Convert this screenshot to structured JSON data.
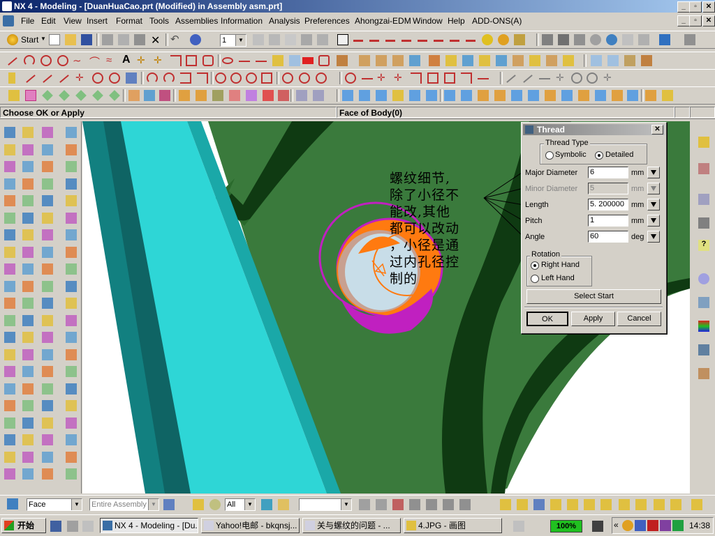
{
  "window": {
    "title": "NX 4 - Modeling - [DuanHuaCao.prt (Modified)  in Assembly asm.prt]",
    "minimize": "_",
    "restore": "▫",
    "close": "✕"
  },
  "menu": [
    "File",
    "Edit",
    "View",
    "Insert",
    "Format",
    "Tools",
    "Assemblies",
    "Information",
    "Analysis",
    "Preferences",
    "Ahongzai-EDM",
    "Window",
    "Help",
    "ADD-ONS(A)"
  ],
  "toolbar": {
    "start_label": "Start",
    "layer_value": "1"
  },
  "cue": {
    "prompt": "Choose OK or Apply",
    "status": "Face of Body(0)"
  },
  "dialog": {
    "title": "Thread",
    "thread_type_label": "Thread Type",
    "thread_type_options": [
      "Symbolic",
      "Detailed"
    ],
    "thread_type_selected": "Detailed",
    "fields": [
      {
        "label": "Major Diameter",
        "value": "6",
        "unit": "mm",
        "enabled": true
      },
      {
        "label": "Minor Diameter",
        "value": "5",
        "unit": "mm",
        "enabled": false
      },
      {
        "label": "Length",
        "value": "5. 200000",
        "unit": "mm",
        "enabled": true
      },
      {
        "label": "Pitch",
        "value": "1",
        "unit": "mm",
        "enabled": true
      },
      {
        "label": "Angle",
        "value": "60",
        "unit": "deg",
        "enabled": true
      }
    ],
    "rotation_label": "Rotation",
    "rotation_options": [
      "Right Hand",
      "Left Hand"
    ],
    "rotation_selected": "Right Hand",
    "select_start_label": "Select Start",
    "ok_label": "OK",
    "apply_label": "Apply",
    "cancel_label": "Cancel"
  },
  "annotation": {
    "lines": [
      "螺纹细节,",
      "除了小径不",
      "能改,其他",
      "都可以改动",
      "，小径是通",
      "过内孔径控",
      "制的"
    ]
  },
  "bottom_toolbar": {
    "filter_value": "Face",
    "scope_value": "Entire Assembly",
    "selection_value": "All"
  },
  "taskbar": {
    "start_label": "开始",
    "tasks": [
      "NX 4 - Modeling - [Du...",
      "Yahoo!电邮 - bkqnsj...",
      "关与螺纹的问题 - ...",
      "4.JPG - 画图"
    ],
    "zoom_level": "100%",
    "clock": "14:38"
  },
  "colors": {
    "title_active": "#0a246a",
    "model_green": "#3a7a3c",
    "model_dark_green": "#0f3a12",
    "model_cyan": "#2ed6d6",
    "model_teal": "#0f6464",
    "thread_magenta": "#c020c0",
    "bore_orange": "#ff7a10"
  }
}
